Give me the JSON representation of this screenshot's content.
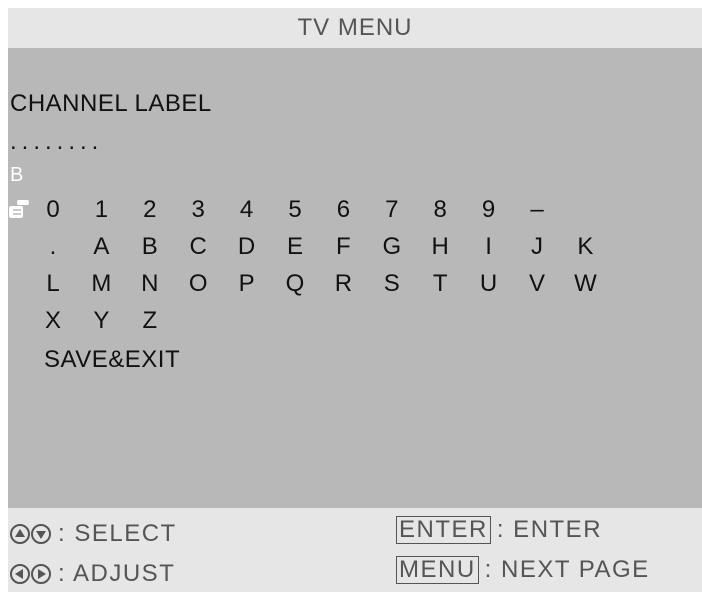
{
  "header": {
    "title": "TV MENU"
  },
  "main": {
    "heading": "CHANNEL LABEL",
    "dots": "........",
    "current_char": "B",
    "keyboard_rows": [
      [
        "0",
        "1",
        "2",
        "3",
        "4",
        "5",
        "6",
        "7",
        "8",
        "9",
        "–"
      ],
      [
        ".",
        "A",
        "B",
        "C",
        "D",
        "E",
        "F",
        "G",
        "H",
        "I",
        "J",
        "K"
      ],
      [
        "L",
        "M",
        "N",
        "O",
        "P",
        "Q",
        "R",
        "S",
        "T",
        "U",
        "V",
        "W"
      ],
      [
        "X",
        "Y",
        "Z"
      ]
    ],
    "save_exit": "SAVE&EXIT",
    "pointer_icon": "hand-pointer-icon"
  },
  "footer": {
    "select_label": ": SELECT",
    "adjust_label": ": ADJUST",
    "enter_key": "ENTER",
    "enter_label": ": ENTER",
    "menu_key": "MENU",
    "menu_label": ": NEXT PAGE",
    "icons": [
      "up-arrow-icon",
      "down-arrow-icon",
      "left-arrow-icon",
      "right-arrow-icon"
    ]
  }
}
